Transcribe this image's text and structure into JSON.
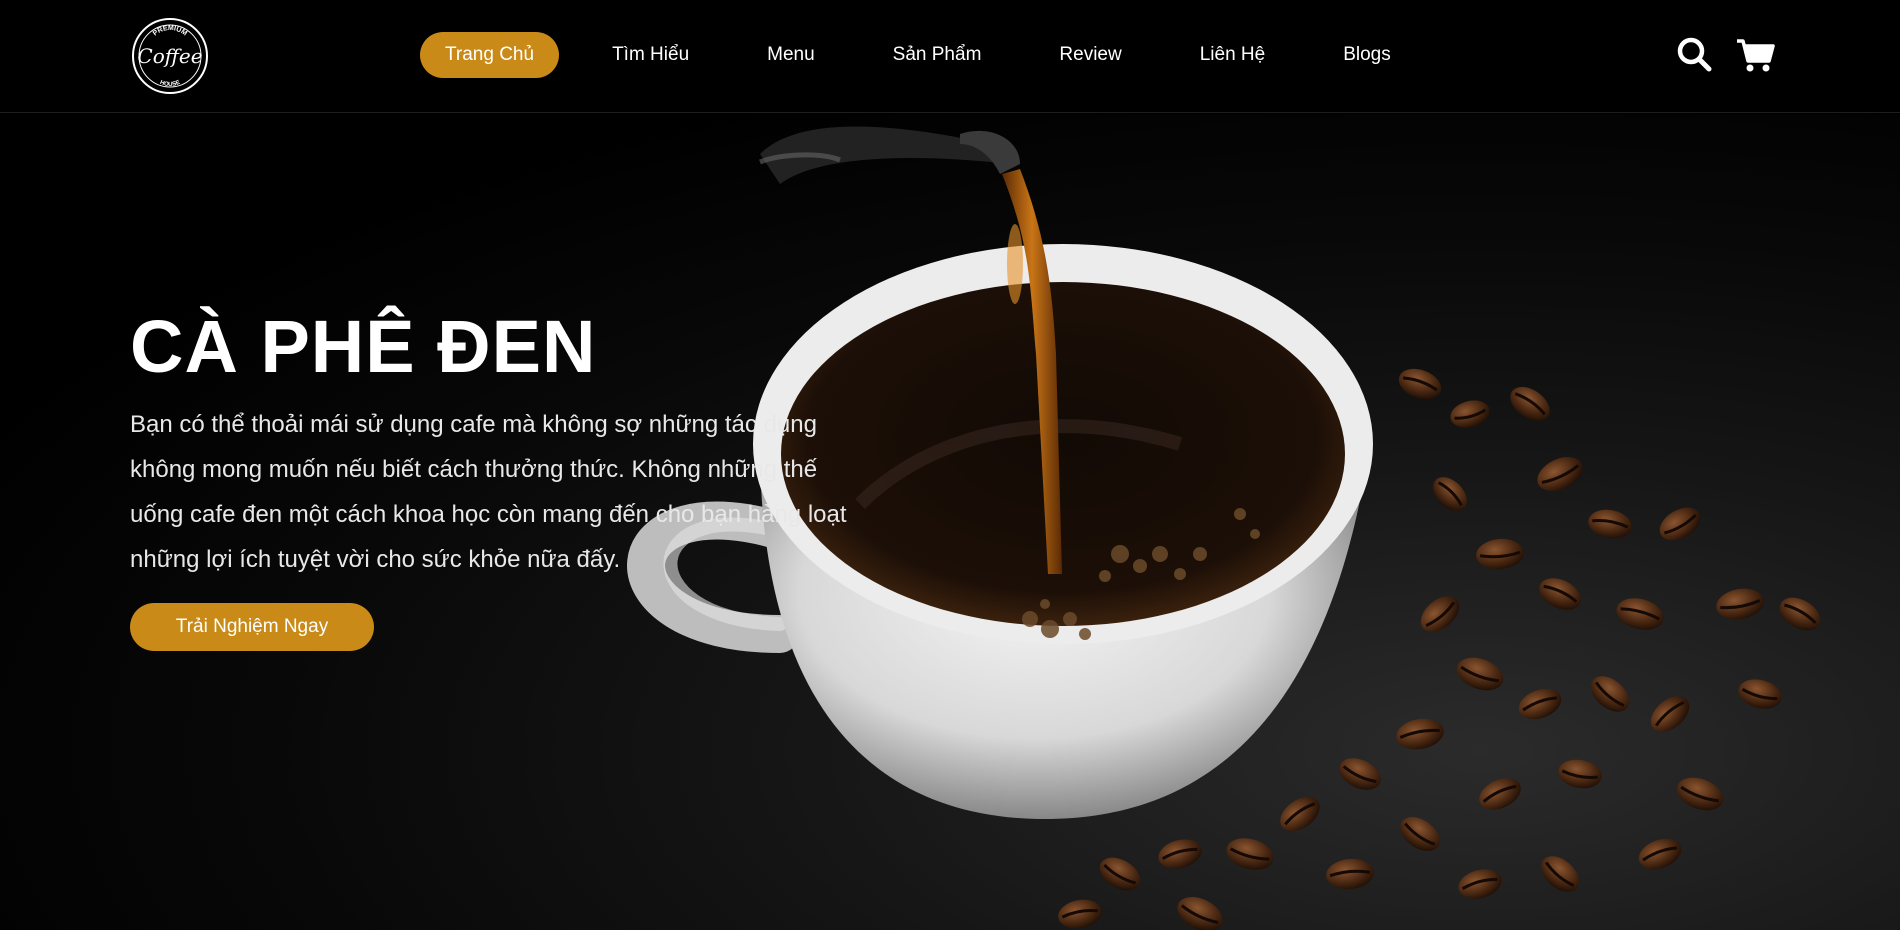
{
  "header": {
    "logo": {
      "top": "PREMIUM",
      "main": "Coffee",
      "bottom": "HOUSE",
      "icon": "coffee-logo"
    },
    "nav": [
      {
        "label": "Trang Chủ",
        "active": true
      },
      {
        "label": "Tìm Hiểu"
      },
      {
        "label": "Menu"
      },
      {
        "label": "Sản Phẩm"
      },
      {
        "label": "Review"
      },
      {
        "label": "Liên Hệ"
      },
      {
        "label": "Blogs"
      }
    ],
    "search_icon": "search-icon",
    "cart_icon": "cart-icon"
  },
  "hero": {
    "title": "CÀ PHÊ ĐEN",
    "description": "Bạn có thể thoải mái sử dụng cafe mà không sợ những tác dụng không mong muốn nếu biết cách thưởng thức. Không những thế uống cafe đen một cách khoa học còn mang đến cho bạn hàng loạt những lợi ích tuyệt vời cho sức khỏe nữa đấy.",
    "cta_label": "Trải Nghiệm Ngay"
  },
  "colors": {
    "accent": "#c98a17",
    "background": "#000000",
    "text": "#ffffff"
  }
}
